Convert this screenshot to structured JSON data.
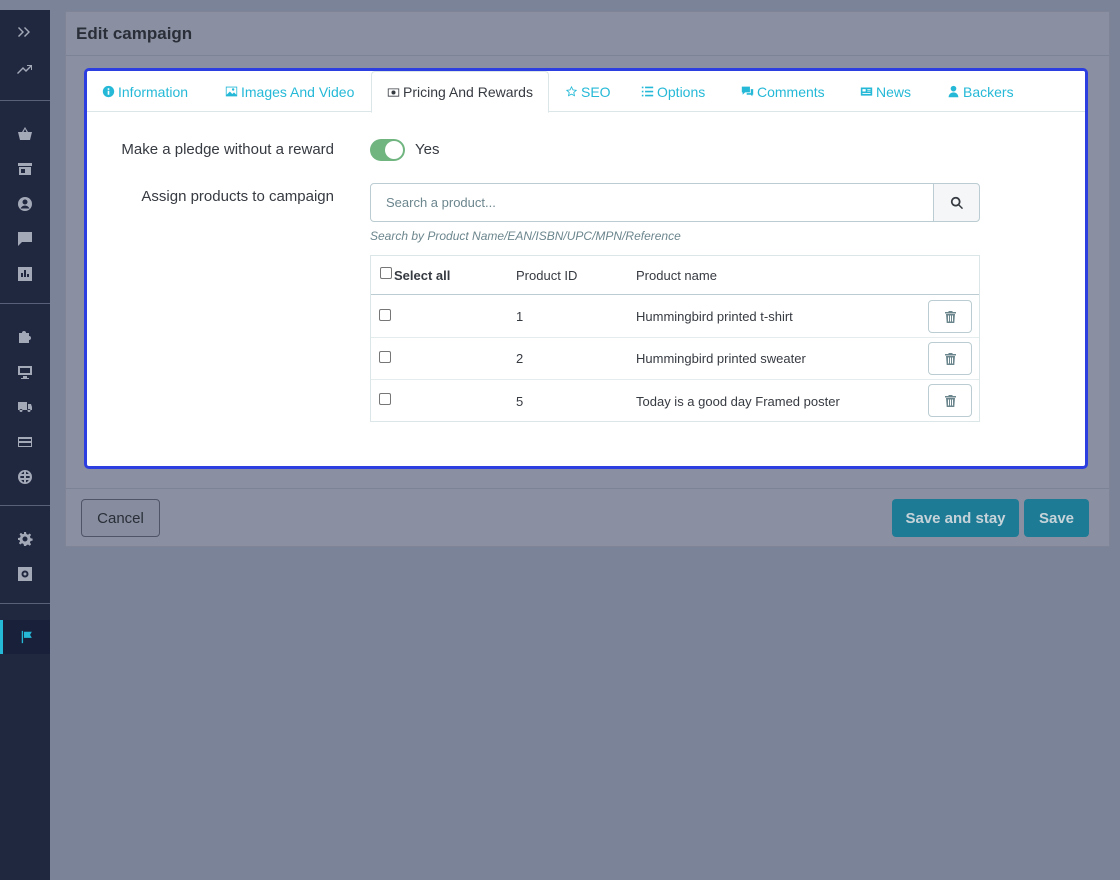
{
  "panel": {
    "title": "Edit campaign"
  },
  "tabs": [
    {
      "label": "Information",
      "icon": "info-circle-icon"
    },
    {
      "label": "Images And Video",
      "icon": "image-icon"
    },
    {
      "label": "Pricing And Rewards",
      "icon": "money-icon",
      "active": true
    },
    {
      "label": "SEO",
      "icon": "star-icon"
    },
    {
      "label": "Options",
      "icon": "list-icon"
    },
    {
      "label": "Comments",
      "icon": "comments-icon"
    },
    {
      "label": "News",
      "icon": "newspaper-icon"
    },
    {
      "label": "Backers",
      "icon": "user-icon"
    }
  ],
  "form": {
    "pledge_label": "Make a pledge without a reward",
    "pledge_value": "Yes",
    "assign_label": "Assign products to campaign",
    "search_placeholder": "Search a product...",
    "search_help": "Search by Product Name/EAN/ISBN/UPC/MPN/Reference"
  },
  "table": {
    "headers": {
      "select_all": "Select all",
      "product_id": "Product ID",
      "product_name": "Product name"
    },
    "rows": [
      {
        "id": "1",
        "name": "Hummingbird printed t-shirt"
      },
      {
        "id": "2",
        "name": "Hummingbird printed sweater"
      },
      {
        "id": "5",
        "name": "Today is a good day Framed poster"
      }
    ]
  },
  "footer": {
    "cancel": "Cancel",
    "save_and_stay": "Save and stay",
    "save": "Save"
  },
  "colors": {
    "accent": "#25b9d7",
    "highlight_border": "#2d3ee0",
    "switch_on": "#70b580",
    "sidebar": "#202840"
  }
}
